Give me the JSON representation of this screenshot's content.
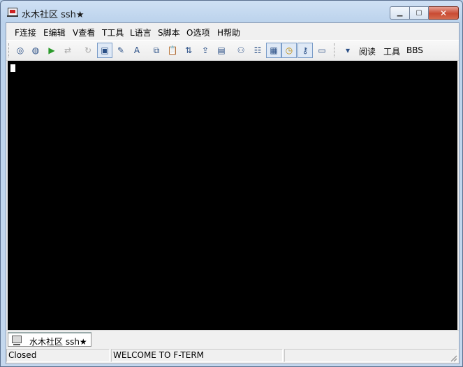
{
  "window": {
    "title": "水木社区 ssh★"
  },
  "controls": {
    "minimize": "▁",
    "maximize": "▢",
    "close": "✕"
  },
  "menu": [
    "F连接",
    "E编辑",
    "V查看",
    "T工具",
    "L语言",
    "S脚本",
    "O选项",
    "H帮助"
  ],
  "toolbar": {
    "buttons": [
      {
        "icon": "connect-icon",
        "glyph": "◎"
      },
      {
        "icon": "globe-icon",
        "glyph": "◍"
      },
      {
        "icon": "play-icon",
        "glyph": "▶"
      },
      {
        "icon": "disconnect-icon",
        "glyph": "⇄"
      },
      {
        "icon": "reconnect-icon",
        "glyph": "↻"
      },
      {
        "icon": "screen-icon",
        "glyph": "▣"
      },
      {
        "icon": "edit-icon",
        "glyph": "✎"
      },
      {
        "icon": "font-icon",
        "glyph": "A"
      },
      {
        "icon": "copy-icon",
        "glyph": "⧉"
      },
      {
        "icon": "paste-icon",
        "glyph": "📋"
      },
      {
        "icon": "transfer-icon",
        "glyph": "⇅"
      },
      {
        "icon": "send-icon",
        "glyph": "⇪"
      },
      {
        "icon": "page-icon",
        "glyph": "▤"
      },
      {
        "icon": "users-icon",
        "glyph": "⚇"
      },
      {
        "icon": "list-icon",
        "glyph": "☷"
      },
      {
        "icon": "image-icon",
        "glyph": "▦"
      },
      {
        "icon": "clock-icon",
        "glyph": "◷"
      },
      {
        "icon": "key-icon",
        "glyph": "⚷"
      },
      {
        "icon": "keyboard-icon",
        "glyph": "▭"
      },
      {
        "icon": "read-icon",
        "glyph": "▾"
      }
    ],
    "text_buttons": [
      "阅读",
      "工具",
      "BBS"
    ]
  },
  "terminal": {
    "background": "#000000",
    "cursor_color": "#ffffff"
  },
  "tab": {
    "label": "水木社区 ssh★"
  },
  "status": {
    "connection": "Closed",
    "message": "WELCOME TO F-TERM"
  }
}
